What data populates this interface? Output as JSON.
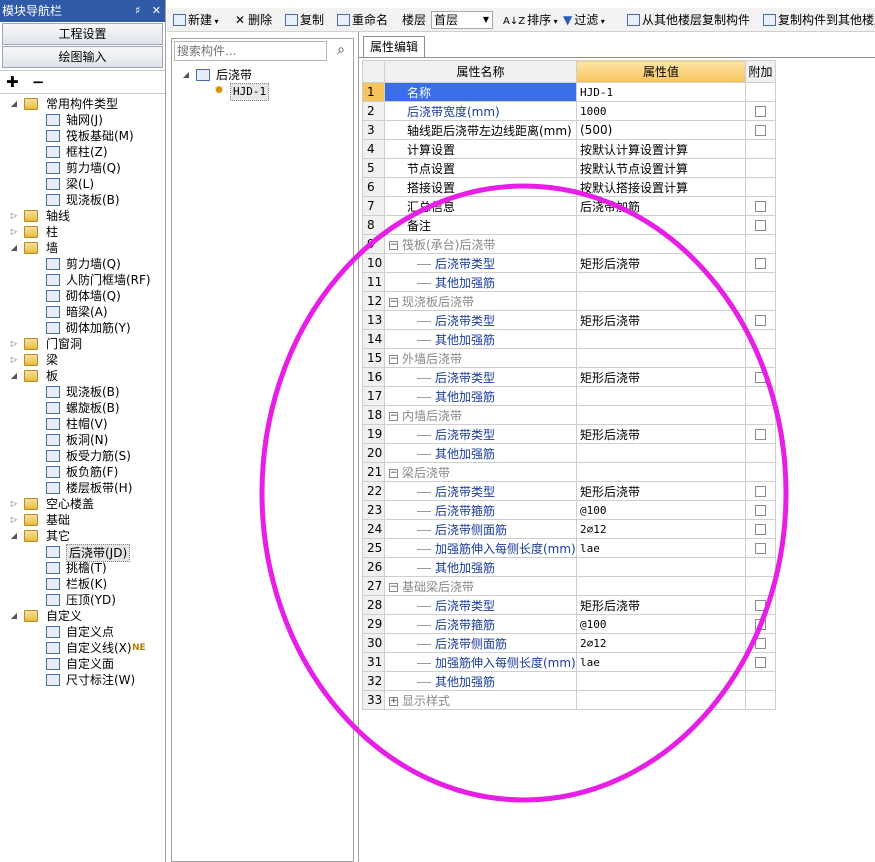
{
  "nav": {
    "title": "模块导航栏",
    "pin": "♯",
    "close": "✕",
    "btn_project": "工程设置",
    "btn_draw": "绘图输入",
    "tool_add": "✚",
    "tool_remove": "−",
    "tree": [
      {
        "l": 0,
        "t": "常用构件类型",
        "x": "◢",
        "f": true
      },
      {
        "l": 1,
        "t": "轴网(J)"
      },
      {
        "l": 1,
        "t": "筏板基础(M)"
      },
      {
        "l": 1,
        "t": "框柱(Z)"
      },
      {
        "l": 1,
        "t": "剪力墙(Q)"
      },
      {
        "l": 1,
        "t": "梁(L)"
      },
      {
        "l": 1,
        "t": "现浇板(B)"
      },
      {
        "l": 0,
        "t": "轴线",
        "x": "▷",
        "f": true
      },
      {
        "l": 0,
        "t": "柱",
        "x": "▷",
        "f": true
      },
      {
        "l": 0,
        "t": "墙",
        "x": "◢",
        "f": true
      },
      {
        "l": 1,
        "t": "剪力墙(Q)"
      },
      {
        "l": 1,
        "t": "人防门框墙(RF)"
      },
      {
        "l": 1,
        "t": "砌体墙(Q)"
      },
      {
        "l": 1,
        "t": "暗梁(A)"
      },
      {
        "l": 1,
        "t": "砌体加筋(Y)"
      },
      {
        "l": 0,
        "t": "门窗洞",
        "x": "▷",
        "f": true
      },
      {
        "l": 0,
        "t": "梁",
        "x": "▷",
        "f": true
      },
      {
        "l": 0,
        "t": "板",
        "x": "◢",
        "f": true
      },
      {
        "l": 1,
        "t": "现浇板(B)"
      },
      {
        "l": 1,
        "t": "螺旋板(B)"
      },
      {
        "l": 1,
        "t": "柱帽(V)"
      },
      {
        "l": 1,
        "t": "板洞(N)"
      },
      {
        "l": 1,
        "t": "板受力筋(S)"
      },
      {
        "l": 1,
        "t": "板负筋(F)"
      },
      {
        "l": 1,
        "t": "楼层板带(H)"
      },
      {
        "l": 0,
        "t": "空心楼盖",
        "x": "▷",
        "f": true
      },
      {
        "l": 0,
        "t": "基础",
        "x": "▷",
        "f": true
      },
      {
        "l": 0,
        "t": "其它",
        "x": "◢",
        "f": true
      },
      {
        "l": 1,
        "t": "后浇带(JD)",
        "sel": true
      },
      {
        "l": 1,
        "t": "挑檐(T)"
      },
      {
        "l": 1,
        "t": "栏板(K)"
      },
      {
        "l": 1,
        "t": "压顶(YD)"
      },
      {
        "l": 0,
        "t": "自定义",
        "x": "◢",
        "f": true
      },
      {
        "l": 1,
        "t": "自定义点"
      },
      {
        "l": 1,
        "t": "自定义线(X)",
        "badge": "NE"
      },
      {
        "l": 1,
        "t": "自定义面"
      },
      {
        "l": 1,
        "t": "尺寸标注(W)"
      }
    ]
  },
  "toolbar": {
    "new": "新建",
    "delete": "删除",
    "copy": "复制",
    "rename": "重命名",
    "floor_label": "楼层",
    "floor_value": "首层",
    "sort": "排序",
    "filter": "过滤",
    "copy_from_other": "从其他楼层复制构件",
    "copy_to_other": "复制构件到其他楼层"
  },
  "components": {
    "search_placeholder": "搜索构件...",
    "root": "后浇带",
    "child": "HJD-1"
  },
  "props": {
    "tab": "属性编辑",
    "col_name": "属性名称",
    "col_value": "属性值",
    "col_extra": "附加",
    "rows": [
      {
        "n": "1",
        "name": "名称",
        "val": "HJD-1",
        "cls": "lv1",
        "cb": false,
        "sel": true
      },
      {
        "n": "2",
        "name": "后浇带宽度(mm)",
        "val": "1000",
        "cls": "lv1 blue",
        "cb": true
      },
      {
        "n": "3",
        "name": "轴线距后浇带左边线距离(mm)",
        "val": "(500)",
        "cls": "lv1",
        "cb": true
      },
      {
        "n": "4",
        "name": "计算设置",
        "val": "按默认计算设置计算",
        "cls": "lv1",
        "cb": false
      },
      {
        "n": "5",
        "name": "节点设置",
        "val": "按默认节点设置计算",
        "cls": "lv1",
        "cb": false
      },
      {
        "n": "6",
        "name": "搭接设置",
        "val": "按默认搭接设置计算",
        "cls": "lv1",
        "cb": false
      },
      {
        "n": "7",
        "name": "汇总信息",
        "val": "后浇带加筋",
        "cls": "lv1",
        "cb": true
      },
      {
        "n": "8",
        "name": "备注",
        "val": "",
        "cls": "lv1",
        "cb": true
      },
      {
        "n": "9",
        "name": "筏板(承台)后浇带",
        "val": "",
        "cls": "grp",
        "cb": false,
        "g": "−"
      },
      {
        "n": "10",
        "name": "后浇带类型",
        "val": "矩形后浇带",
        "cls": "lv2",
        "cb": true
      },
      {
        "n": "11",
        "name": "其他加强筋",
        "val": "",
        "cls": "lv2",
        "cb": false
      },
      {
        "n": "12",
        "name": "现浇板后浇带",
        "val": "",
        "cls": "grp",
        "cb": false,
        "g": "−"
      },
      {
        "n": "13",
        "name": "后浇带类型",
        "val": "矩形后浇带",
        "cls": "lv2",
        "cb": true
      },
      {
        "n": "14",
        "name": "其他加强筋",
        "val": "",
        "cls": "lv2",
        "cb": false
      },
      {
        "n": "15",
        "name": "外墙后浇带",
        "val": "",
        "cls": "grp",
        "cb": false,
        "g": "−"
      },
      {
        "n": "16",
        "name": "后浇带类型",
        "val": "矩形后浇带",
        "cls": "lv2",
        "cb": true
      },
      {
        "n": "17",
        "name": "其他加强筋",
        "val": "",
        "cls": "lv2",
        "cb": false
      },
      {
        "n": "18",
        "name": "内墙后浇带",
        "val": "",
        "cls": "grp",
        "cb": false,
        "g": "−"
      },
      {
        "n": "19",
        "name": "后浇带类型",
        "val": "矩形后浇带",
        "cls": "lv2",
        "cb": true
      },
      {
        "n": "20",
        "name": "其他加强筋",
        "val": "",
        "cls": "lv2",
        "cb": false
      },
      {
        "n": "21",
        "name": "梁后浇带",
        "val": "",
        "cls": "grp",
        "cb": false,
        "g": "−"
      },
      {
        "n": "22",
        "name": "后浇带类型",
        "val": "矩形后浇带",
        "cls": "lv2",
        "cb": true
      },
      {
        "n": "23",
        "name": "后浇带箍筋",
        "val": "@100",
        "cls": "lv2",
        "cb": true
      },
      {
        "n": "24",
        "name": "后浇带侧面筋",
        "val": "2⌀12",
        "cls": "lv2",
        "cb": true
      },
      {
        "n": "25",
        "name": "加强筋伸入每侧长度(mm)",
        "val": "lae",
        "cls": "lv2",
        "cb": true
      },
      {
        "n": "26",
        "name": "其他加强筋",
        "val": "",
        "cls": "lv2",
        "cb": false
      },
      {
        "n": "27",
        "name": "基础梁后浇带",
        "val": "",
        "cls": "grp",
        "cb": false,
        "g": "−"
      },
      {
        "n": "28",
        "name": "后浇带类型",
        "val": "矩形后浇带",
        "cls": "lv2",
        "cb": true
      },
      {
        "n": "29",
        "name": "后浇带箍筋",
        "val": "@100",
        "cls": "lv2",
        "cb": true
      },
      {
        "n": "30",
        "name": "后浇带侧面筋",
        "val": "2⌀12",
        "cls": "lv2",
        "cb": true
      },
      {
        "n": "31",
        "name": "加强筋伸入每侧长度(mm)",
        "val": "lae",
        "cls": "lv2",
        "cb": true
      },
      {
        "n": "32",
        "name": "其他加强筋",
        "val": "",
        "cls": "lv2",
        "cb": false
      },
      {
        "n": "33",
        "name": "显示样式",
        "val": "",
        "cls": "grp",
        "cb": false,
        "g": "+"
      }
    ]
  },
  "colors": {
    "nav_title_bg": "#2f5aa8",
    "selected_row": "#3a6ee8",
    "header_value": "#f6c35c",
    "annotation": "#e61ee6"
  }
}
